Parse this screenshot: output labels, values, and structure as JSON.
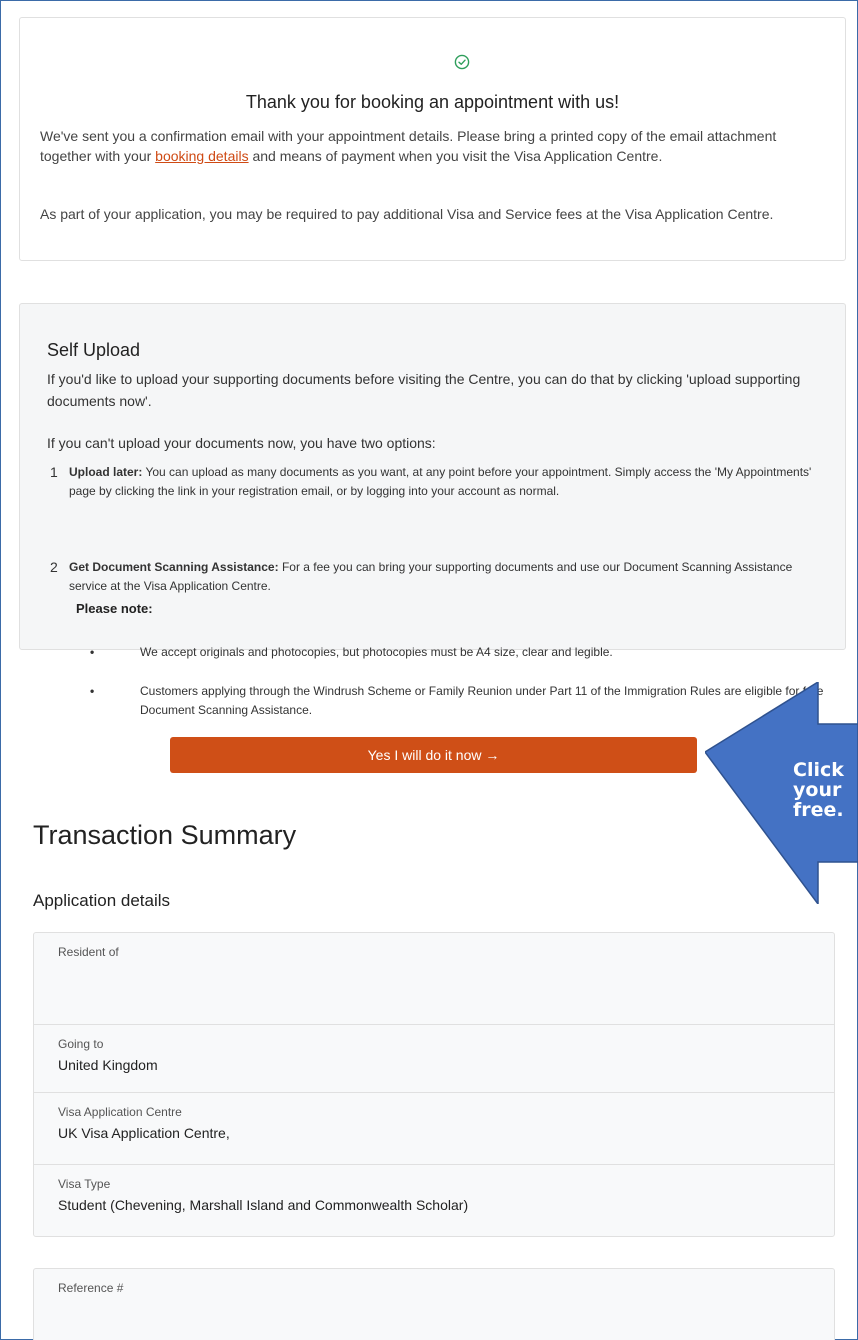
{
  "confirmation": {
    "icon": "check-circle-icon",
    "accent": "#2e9e5b",
    "heading": "Thank you for booking an appointment with us!",
    "para1_before": "We've sent you a confirmation email with your appointment details. Please bring a printed copy of the email attachment together with your ",
    "para1_link": "booking details",
    "para1_after": " and means of payment when you visit the Visa Application Centre.",
    "para2": "As part of your application, you may be required to pay additional Visa and Service fees at the Visa Application Centre."
  },
  "self_upload": {
    "title": "Self Upload",
    "intro": "If you'd like to upload your supporting documents before visiting the Centre, you can do that by clicking 'upload supporting documents now'.",
    "options_intro": "If you can't upload your documents now, you have two options:",
    "items": [
      {
        "number": "1",
        "label": "Upload later:",
        "text": " You can upload as many documents as you want, at any point before your appointment. Simply access the 'My Appointments' page by clicking the link in your registration email, or by logging into your account as normal."
      },
      {
        "number": "2",
        "label": "Get Document Scanning Assistance:",
        "text": " For a fee you can bring your supporting documents and use our Document Scanning Assistance service at the Visa Application Centre."
      }
    ],
    "note_label": "Please note:",
    "bullets": [
      "We accept originals and photocopies, but photocopies must be A4 size, clear and legible.",
      "Customers applying through the Windrush Scheme or Family Reunion under Part 11 of the Immigration Rules are eligible for free Document Scanning Assistance."
    ],
    "cta_label": "Yes I will do it now →",
    "cta_color": "#cf4f17"
  },
  "callout": {
    "lines": [
      "Click",
      "your",
      "free."
    ],
    "fill": "#4472c4"
  },
  "transaction": {
    "title": "Transaction Summary",
    "subtitle": "Application details",
    "rows": [
      {
        "label": "Resident of",
        "value": ""
      },
      {
        "label": "Going to",
        "value": "United Kingdom"
      },
      {
        "label": "Visa Application Centre",
        "value": "UK Visa Application Centre,"
      },
      {
        "label": "Visa Type",
        "value": "Student (Chevening, Marshall Island and Commonwealth Scholar)"
      }
    ],
    "reference_label": "Reference #"
  }
}
